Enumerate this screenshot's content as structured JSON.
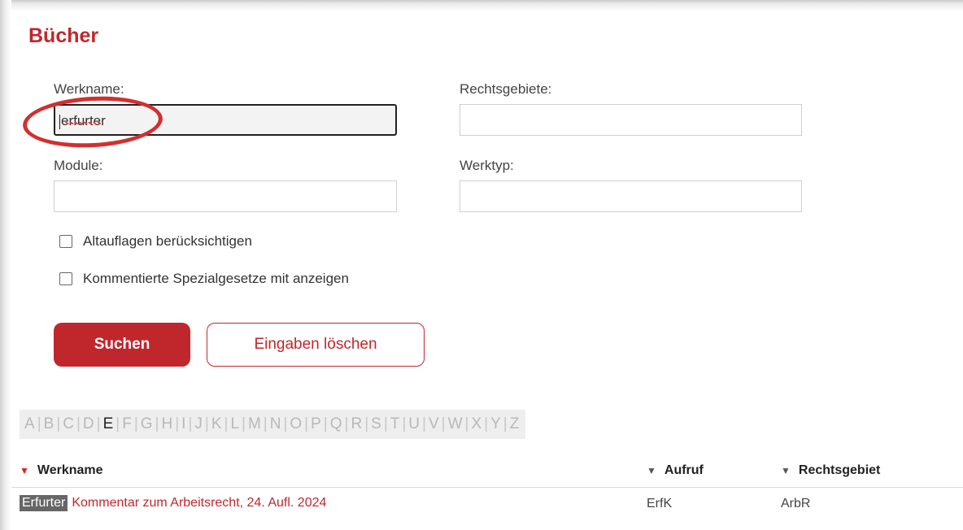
{
  "page": {
    "title": "Bücher"
  },
  "form": {
    "werkname": {
      "label": "Werkname:",
      "value": "erfurter"
    },
    "rechtsgebiete": {
      "label": "Rechtsgebiete:",
      "value": ""
    },
    "module": {
      "label": "Module:",
      "value": ""
    },
    "werktyp": {
      "label": "Werktyp:",
      "value": ""
    },
    "checkboxes": [
      {
        "label": "Altauflagen berücksichtigen",
        "checked": false
      },
      {
        "label": "Kommentierte Spezialgesetze mit anzeigen",
        "checked": false
      }
    ],
    "search_button": "Suchen",
    "clear_button": "Eingaben löschen"
  },
  "alphabet": {
    "letters": [
      "A",
      "B",
      "C",
      "D",
      "E",
      "F",
      "G",
      "H",
      "I",
      "J",
      "K",
      "L",
      "M",
      "N",
      "O",
      "P",
      "Q",
      "R",
      "S",
      "T",
      "U",
      "V",
      "W",
      "X",
      "Y",
      "Z"
    ],
    "active": "E"
  },
  "table": {
    "columns": [
      "Werkname",
      "Aufruf",
      "Rechtsgebiet"
    ],
    "rows": [
      {
        "tag": "Erfurter",
        "title": "Kommentar zum Arbeitsrecht, 24. Aufl. 2024",
        "aufruf": "ErfK",
        "rechtsgebiet": "ArbR"
      }
    ]
  },
  "colors": {
    "accent": "#c0272d",
    "annotation": "#d32f2f"
  },
  "icons": {
    "sort_active": "triangle-down-red",
    "sort_inactive": "triangle-down-gray"
  }
}
